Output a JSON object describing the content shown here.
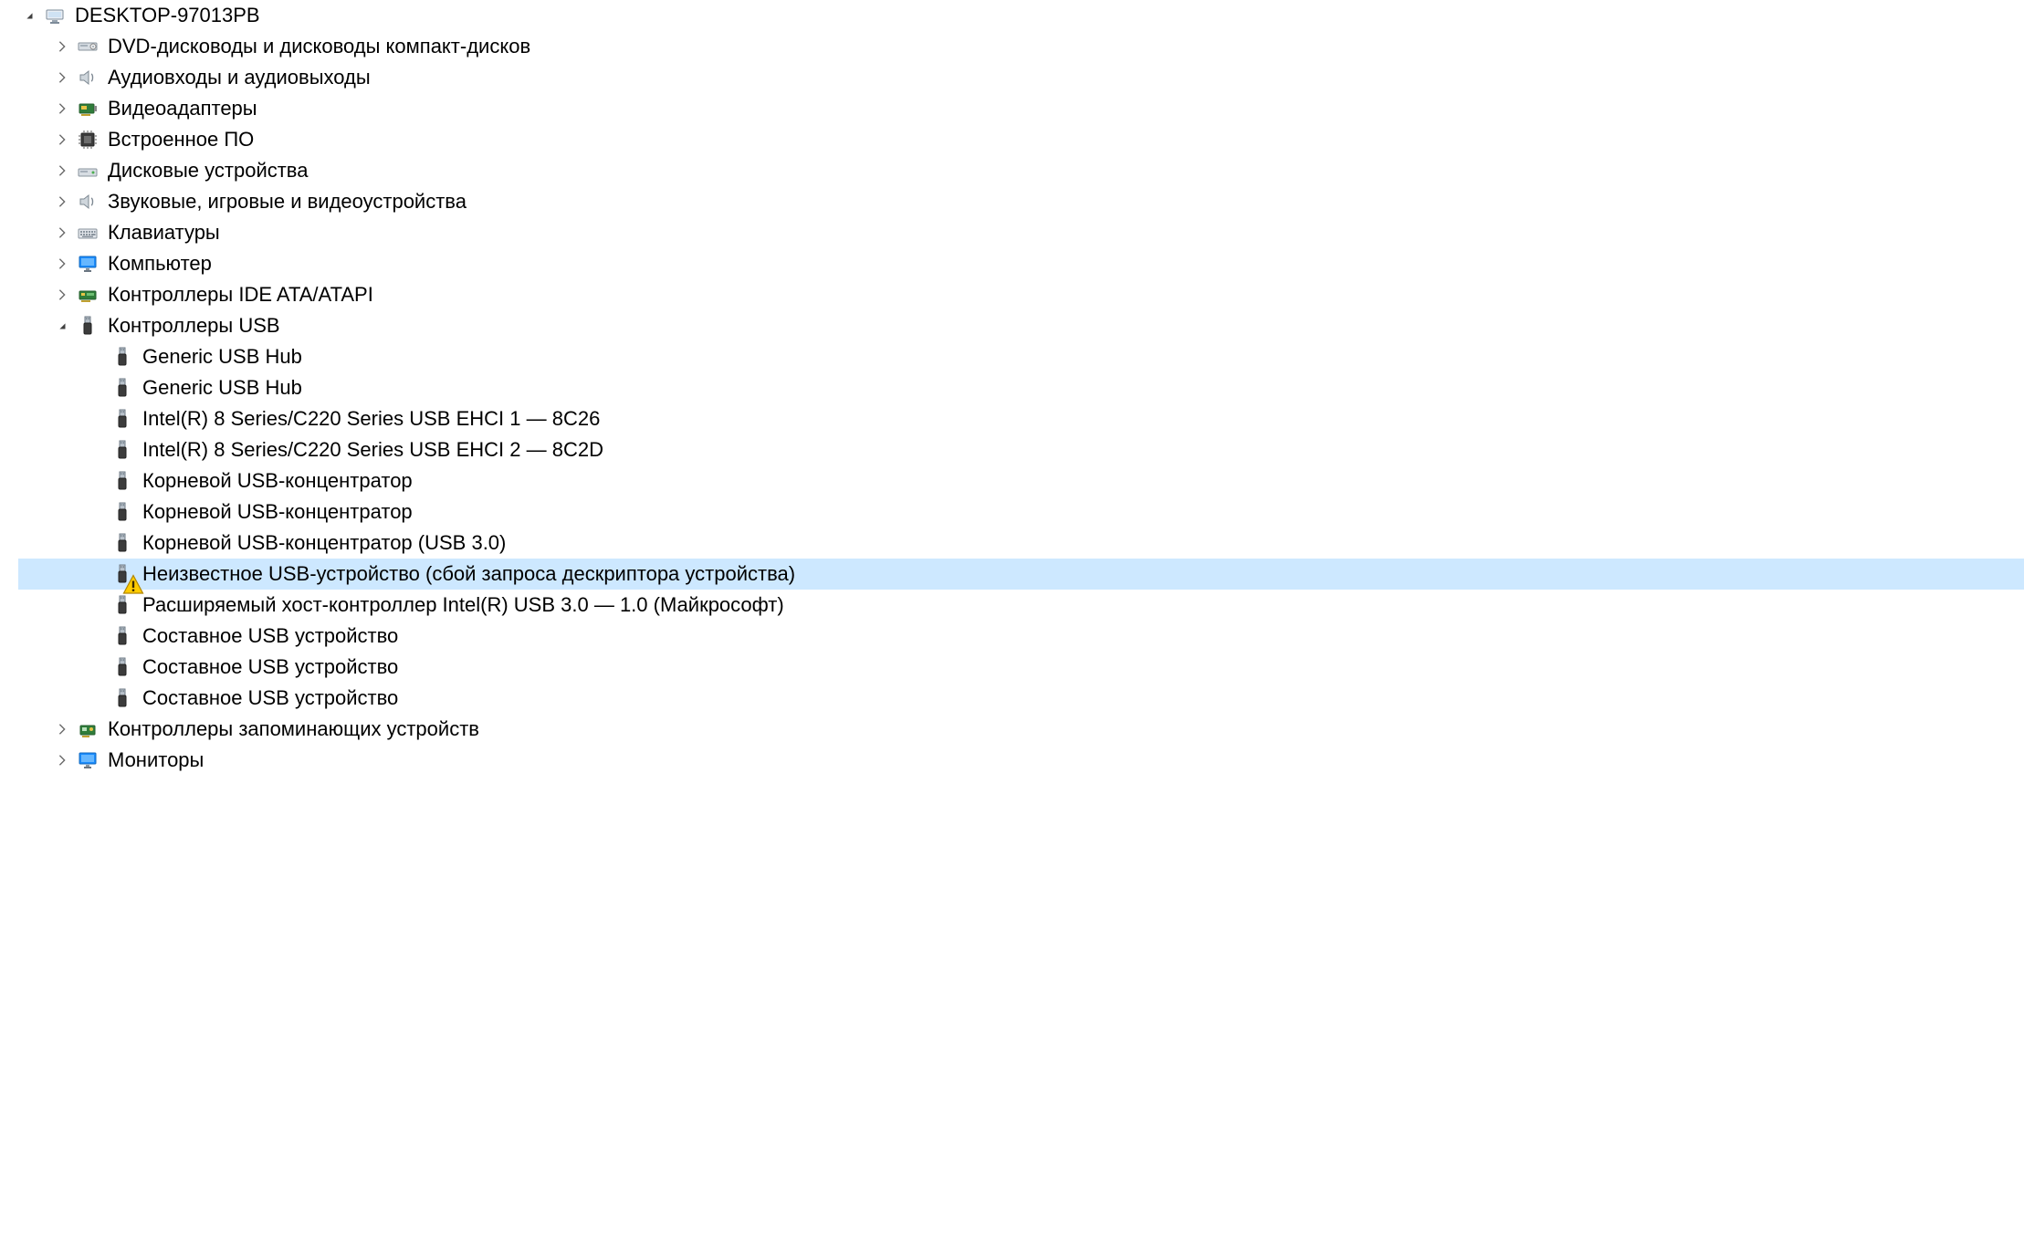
{
  "tree": {
    "root": {
      "label": "DESKTOP-97013PB",
      "icon": "computer-icon",
      "expanded": true
    },
    "categories": [
      {
        "label": "DVD-дисководы и дисководы компакт-дисков",
        "icon": "dvd-drive-icon",
        "expanded": false
      },
      {
        "label": "Аудиовходы и аудиовыходы",
        "icon": "speaker-icon",
        "expanded": false
      },
      {
        "label": "Видеоадаптеры",
        "icon": "display-adapter-icon",
        "expanded": false
      },
      {
        "label": "Встроенное ПО",
        "icon": "firmware-icon",
        "expanded": false
      },
      {
        "label": "Дисковые устройства",
        "icon": "disk-drive-icon",
        "expanded": false
      },
      {
        "label": "Звуковые, игровые и видеоустройства",
        "icon": "speaker-icon",
        "expanded": false
      },
      {
        "label": "Клавиатуры",
        "icon": "keyboard-icon",
        "expanded": false
      },
      {
        "label": "Компьютер",
        "icon": "monitor-icon",
        "expanded": false
      },
      {
        "label": "Контроллеры IDE ATA/ATAPI",
        "icon": "ide-controller-icon",
        "expanded": false
      },
      {
        "label": "Контроллеры USB",
        "icon": "usb-icon",
        "expanded": true,
        "children": [
          {
            "label": "Generic USB Hub",
            "icon": "usb-icon",
            "warning": false,
            "selected": false
          },
          {
            "label": "Generic USB Hub",
            "icon": "usb-icon",
            "warning": false,
            "selected": false
          },
          {
            "label": "Intel(R) 8 Series/C220 Series USB EHCI 1 — 8C26",
            "icon": "usb-icon",
            "warning": false,
            "selected": false
          },
          {
            "label": "Intel(R) 8 Series/C220 Series USB EHCI 2 — 8C2D",
            "icon": "usb-icon",
            "warning": false,
            "selected": false
          },
          {
            "label": "Корневой USB-концентратор",
            "icon": "usb-icon",
            "warning": false,
            "selected": false
          },
          {
            "label": "Корневой USB-концентратор",
            "icon": "usb-icon",
            "warning": false,
            "selected": false
          },
          {
            "label": "Корневой USB-концентратор (USB 3.0)",
            "icon": "usb-icon",
            "warning": false,
            "selected": false
          },
          {
            "label": "Неизвестное USB-устройство (сбой запроса дескриптора устройства)",
            "icon": "usb-icon",
            "warning": true,
            "selected": true
          },
          {
            "label": "Расширяемый хост-контроллер Intel(R) USB 3.0 — 1.0 (Майкрософт)",
            "icon": "usb-icon",
            "warning": false,
            "selected": false
          },
          {
            "label": "Составное USB устройство",
            "icon": "usb-icon",
            "warning": false,
            "selected": false
          },
          {
            "label": "Составное USB устройство",
            "icon": "usb-icon",
            "warning": false,
            "selected": false
          },
          {
            "label": "Составное USB устройство",
            "icon": "usb-icon",
            "warning": false,
            "selected": false
          }
        ]
      },
      {
        "label": "Контроллеры запоминающих устройств",
        "icon": "storage-controller-icon",
        "expanded": false
      },
      {
        "label": "Мониторы",
        "icon": "monitor-icon",
        "expanded": false
      }
    ]
  },
  "colors": {
    "selection": "#cde8ff",
    "chevron": "#5a5a5a",
    "chevronOpen": "#404040"
  }
}
